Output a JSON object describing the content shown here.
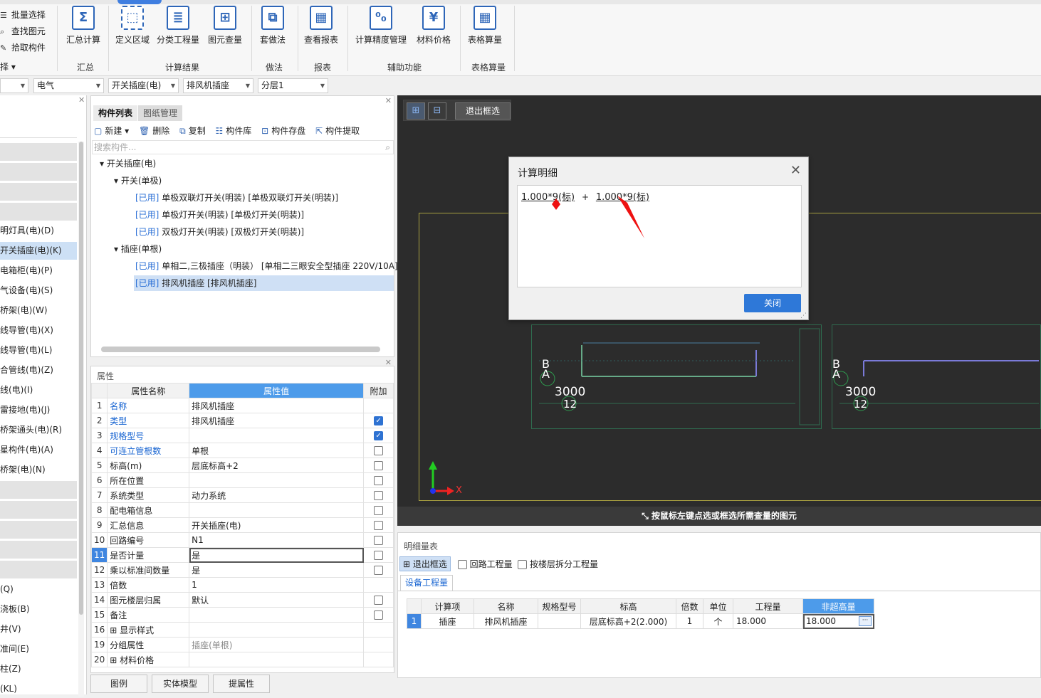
{
  "ribbon": {
    "small_buttons": [
      "批量选择",
      "查找图元",
      "拾取构件"
    ],
    "select_dropdown": "选择",
    "groups": {
      "huizong": "汇总",
      "jisuan": "计算结果",
      "zuofa": "做法",
      "baobiao": "报表",
      "fuzhu": "辅助功能",
      "biaoge": "表格算量"
    },
    "buttons": [
      {
        "label": "汇总计算",
        "icon": "sum-icon",
        "glyph": "Σ"
      },
      {
        "label": "定义区域",
        "icon": "region-icon",
        "glyph": "⬚"
      },
      {
        "label": "分类工程量",
        "icon": "classify-icon",
        "glyph": "≣"
      },
      {
        "label": "图元查量",
        "icon": "element-query-icon",
        "glyph": "⊞"
      },
      {
        "label": "套做法",
        "icon": "method-icon",
        "glyph": "⧉"
      },
      {
        "label": "查看报表",
        "icon": "report-icon",
        "glyph": "▦"
      },
      {
        "label": "计算精度管理",
        "icon": "precision-icon",
        "glyph": "⁰₀"
      },
      {
        "label": "材料价格",
        "icon": "price-icon",
        "glyph": "¥"
      },
      {
        "label": "表格算量",
        "icon": "table-calc-icon",
        "glyph": "▦"
      }
    ]
  },
  "filters": [
    "电气",
    "开关插座(电)",
    "排风机插座",
    "分层1"
  ],
  "left_nav": [
    "明灯具(电)(D)",
    "开关插座(电)(K)",
    "电箱柜(电)(P)",
    "气设备(电)(S)",
    "桥架(电)(W)",
    "线导管(电)(X)",
    "线导管(电)(L)",
    "合管线(电)(Z)",
    "线(电)(I)",
    "雷接地(电)(J)",
    "桥架通头(电)(R)",
    "星构件(电)(A)",
    "桥架(电)(N)",
    "(Q)",
    "浇板(B)",
    "井(V)",
    "准间(E)",
    "柱(Z)",
    "(KL)"
  ],
  "component_list": {
    "tabs": [
      "构件列表",
      "图纸管理"
    ],
    "toolbar": [
      "新建",
      "删除",
      "复制",
      "构件库",
      "构件存盘",
      "构件提取"
    ],
    "search_placeholder": "搜索构件...",
    "tree": {
      "root": "开关插座(电)",
      "group1": "开关(单极)",
      "items1": [
        {
          "tag": "[已用]",
          "text": "单极双联灯开关(明装) [单极双联灯开关(明装)]"
        },
        {
          "tag": "[已用]",
          "text": "单极灯开关(明装) [单极灯开关(明装)]"
        },
        {
          "tag": "[已用]",
          "text": "双极灯开关(明装) [双极灯开关(明装)]"
        }
      ],
      "group2": "插座(单根)",
      "items2": [
        {
          "tag": "[已用]",
          "text": "单相二,三极插座（明装） [单相二三眼安全型插座 220V/10A]"
        },
        {
          "tag": "[已用]",
          "text": "排风机插座 [排风机插座]"
        }
      ]
    }
  },
  "properties": {
    "title": "属性",
    "headers": [
      "属性名称",
      "属性值",
      "附加"
    ],
    "rows": [
      {
        "n": "1",
        "k": "名称",
        "v": "排风机插座",
        "blue": true,
        "cb": null
      },
      {
        "n": "2",
        "k": "类型",
        "v": "排风机插座",
        "blue": true,
        "cb": true
      },
      {
        "n": "3",
        "k": "规格型号",
        "v": "",
        "blue": true,
        "cb": true
      },
      {
        "n": "4",
        "k": "可连立管根数",
        "v": "单根",
        "blue": true,
        "cb": false
      },
      {
        "n": "5",
        "k": "标高(m)",
        "v": "层底标高+2",
        "blue": false,
        "cb": false
      },
      {
        "n": "6",
        "k": "所在位置",
        "v": "",
        "blue": false,
        "cb": false
      },
      {
        "n": "7",
        "k": "系统类型",
        "v": "动力系统",
        "blue": false,
        "cb": false
      },
      {
        "n": "8",
        "k": "配电箱信息",
        "v": "",
        "blue": false,
        "cb": false
      },
      {
        "n": "9",
        "k": "汇总信息",
        "v": "开关插座(电)",
        "blue": false,
        "cb": false
      },
      {
        "n": "10",
        "k": "回路编号",
        "v": "N1",
        "blue": false,
        "cb": false
      },
      {
        "n": "11",
        "k": "是否计量",
        "v": "是",
        "blue": false,
        "cb": false
      },
      {
        "n": "12",
        "k": "乘以标准间数量",
        "v": "是",
        "blue": false,
        "cb": false
      },
      {
        "n": "13",
        "k": "倍数",
        "v": "1",
        "blue": false,
        "cb": null
      },
      {
        "n": "14",
        "k": "图元楼层归属",
        "v": "默认",
        "blue": false,
        "cb": false
      },
      {
        "n": "15",
        "k": "备注",
        "v": "",
        "blue": false,
        "cb": false
      },
      {
        "n": "16",
        "k": "⊞ 显示样式",
        "v": "",
        "blue": false,
        "cb": null
      },
      {
        "n": "19",
        "k": "分组属性",
        "v": "插座(单根)",
        "blue": false,
        "cb": null
      },
      {
        "n": "20",
        "k": "⊞ 材料价格",
        "v": "",
        "blue": false,
        "cb": null
      }
    ]
  },
  "bottom_tabs": [
    "图例",
    "实体模型",
    "提属性"
  ],
  "canvas": {
    "exit_select": "退出框选",
    "status": "按鼠标左键点选或框选所需查量的图元",
    "labels_left": [
      "B",
      "A",
      "3000",
      "12"
    ],
    "axis_x": "X"
  },
  "dialog": {
    "title": "计算明细",
    "formula_a": "1.000*9(标)",
    "plus": "+",
    "formula_b": "1.000*9(标)",
    "close": "关闭"
  },
  "detail": {
    "title": "明细量表",
    "exit_select": "退出框选",
    "chk1": "回路工程量",
    "chk2": "按楼层拆分工程量",
    "tab": "设备工程量",
    "headers": [
      "计算项",
      "名称",
      "规格型号",
      "标高",
      "倍数",
      "单位",
      "工程量",
      "非超高量"
    ],
    "row": {
      "n": "1",
      "item": "插座",
      "name": "排风机插座",
      "spec": "",
      "elev": "层底标高+2(2.000)",
      "mult": "1",
      "unit": "个",
      "qty": "18.000",
      "nonhigh": "18.000"
    }
  }
}
